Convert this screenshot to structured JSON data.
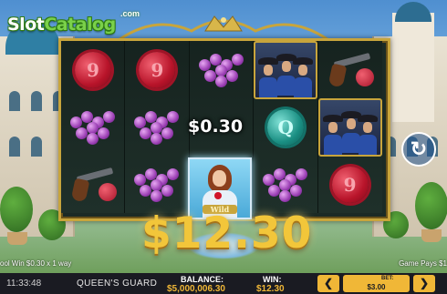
{
  "brand": {
    "logo_part1": "Slot",
    "logo_part2": "Catalog",
    "logo_suffix": ".com"
  },
  "reels": {
    "col1": [
      {
        "symbol": "red-seal",
        "glyph": "9"
      },
      {
        "symbol": "grapes"
      },
      {
        "symbol": "pistol"
      }
    ],
    "col2": [
      {
        "symbol": "red-seal",
        "glyph": "9"
      },
      {
        "symbol": "grapes"
      },
      {
        "symbol": "grapes"
      }
    ],
    "col3": [
      {
        "symbol": "grapes"
      },
      {
        "symbol": "empty"
      },
      {
        "symbol": "queen",
        "plaque": "Wild"
      }
    ],
    "col4": [
      {
        "symbol": "musketeers"
      },
      {
        "symbol": "teal-seal",
        "glyph": "Q"
      },
      {
        "symbol": "grapes"
      }
    ],
    "col5": [
      {
        "symbol": "pistol"
      },
      {
        "symbol": "musketeers"
      },
      {
        "symbol": "red-seal",
        "glyph": "9"
      }
    ]
  },
  "win": {
    "line_amount": "$0.30",
    "total_amount": "$12.30"
  },
  "ticker": {
    "left": "ool Win $0.30 x 1 way",
    "right": "Game Pays $1"
  },
  "bar": {
    "time": "11:33:48",
    "game_name": "QUEEN'S GUARD",
    "balance_label": "BALANCE:",
    "balance_value": "$5,000,006.30",
    "win_label": "WIN:",
    "win_value": "$12.30",
    "bet_label": "BET:",
    "bet_value": "$3.00",
    "bet_decrease": "❮",
    "bet_increase": "❯"
  },
  "colors": {
    "accent_gold": "#f0b737",
    "frame_gold": "#c8a53c",
    "bar_bg": "#1a1b22"
  }
}
